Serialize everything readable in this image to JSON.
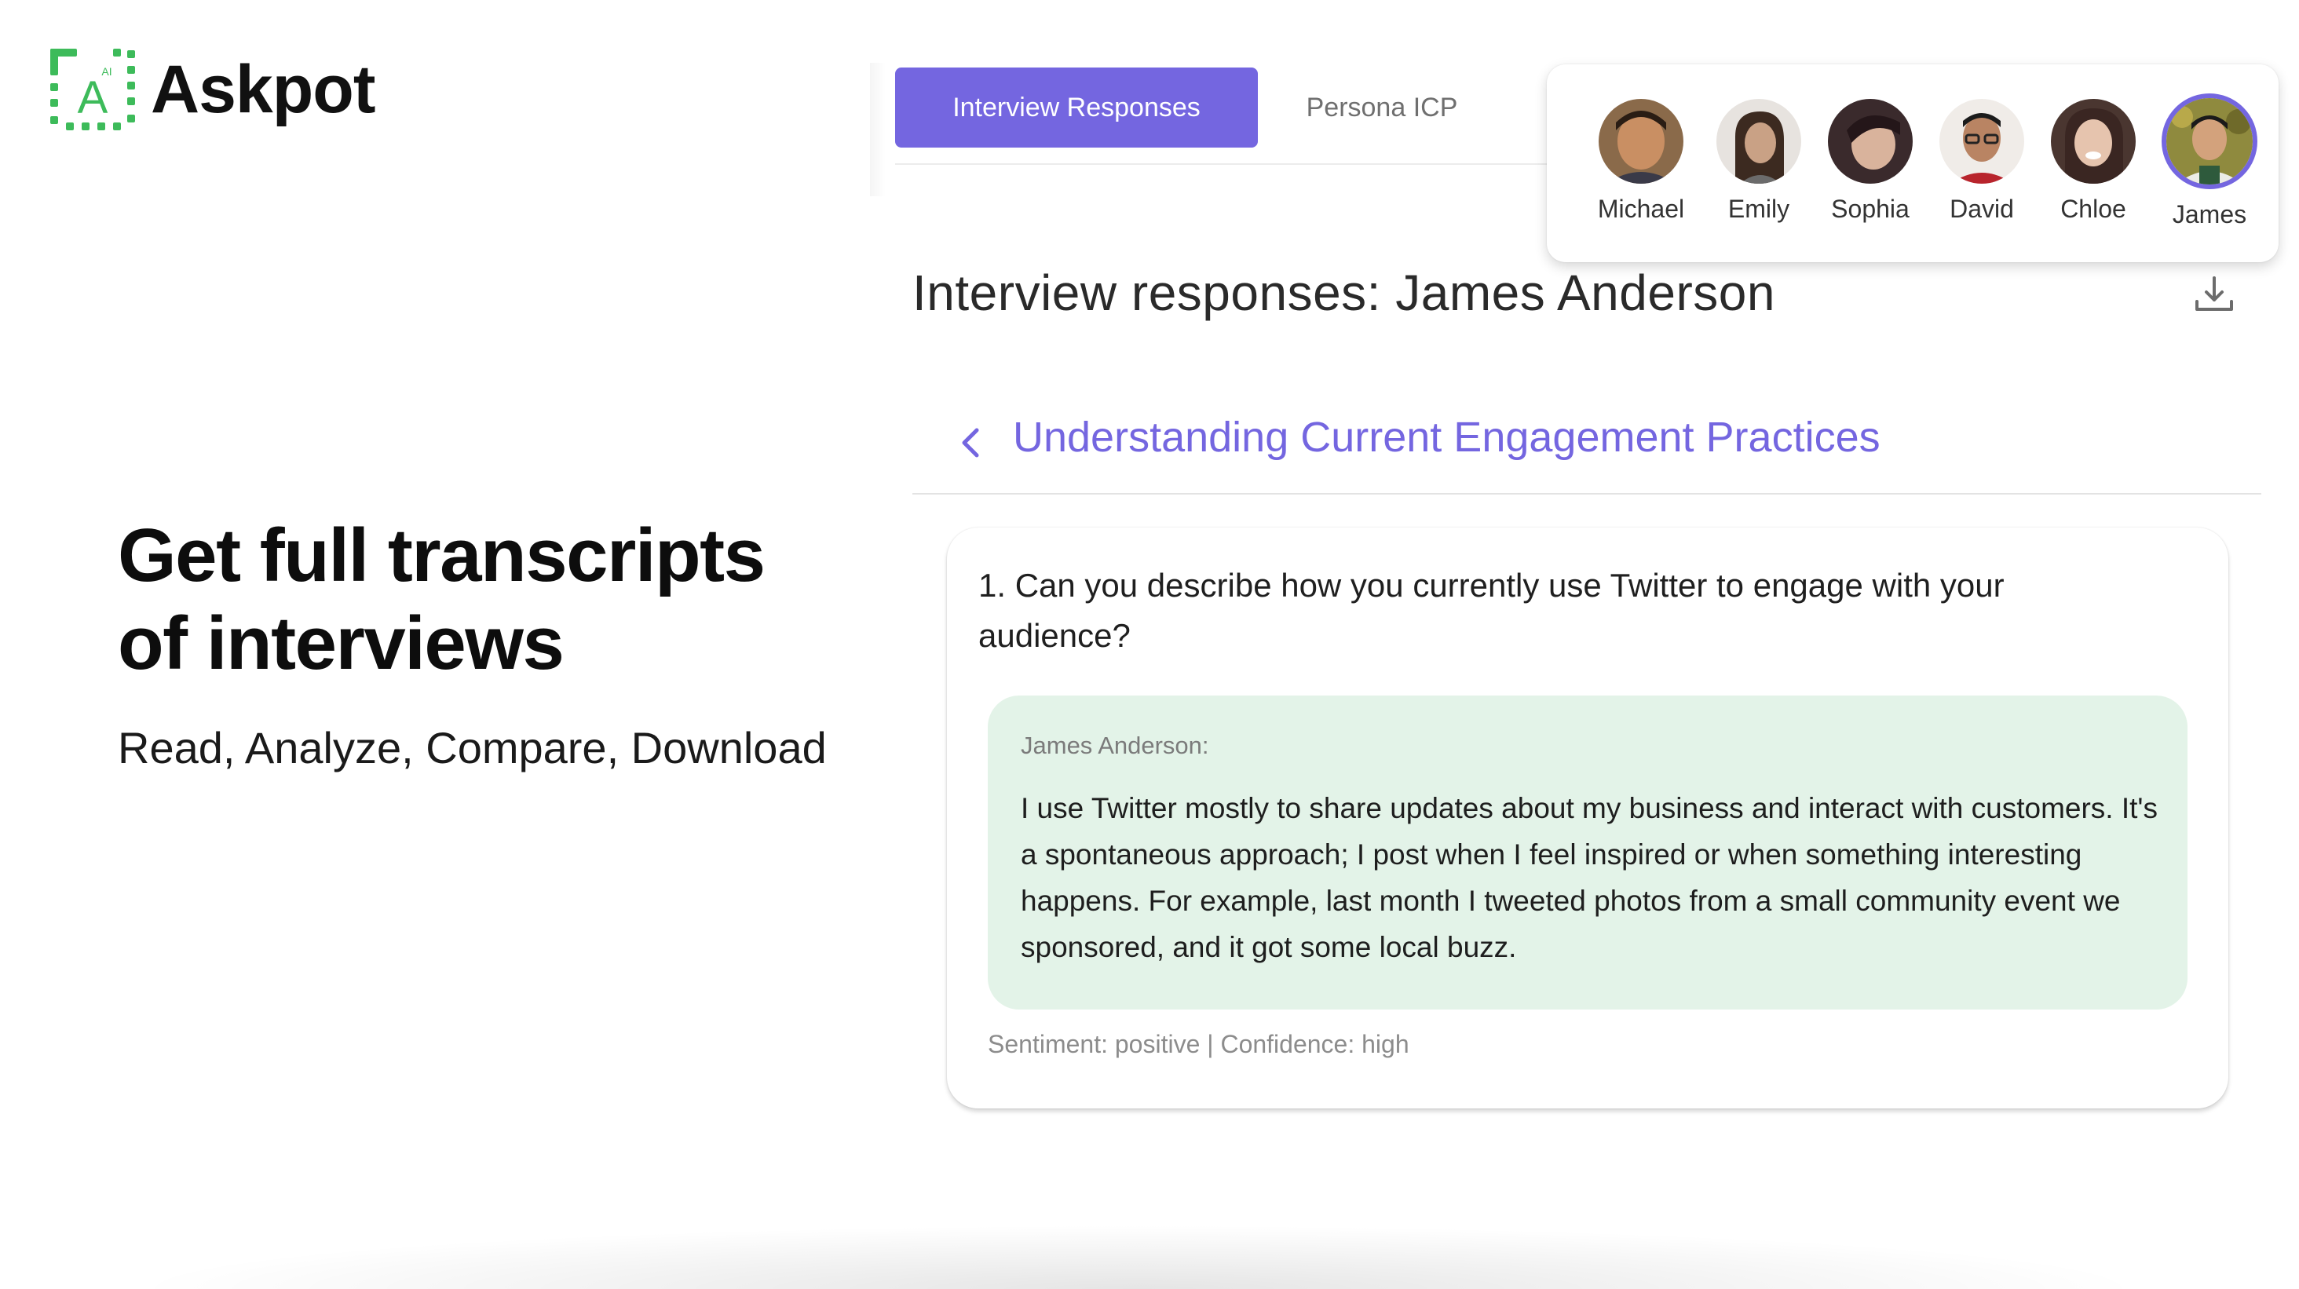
{
  "brand": {
    "logo_text": "Askpot",
    "logo_badge": "AI",
    "logo_letter": "A",
    "accent_green": "#3dbb5a"
  },
  "hero": {
    "title_line1": "Get full transcripts",
    "title_line2": "of interviews",
    "subtitle": "Read, Analyze, Compare, Download"
  },
  "tabs": [
    {
      "label": "Interview Responses",
      "active": true
    },
    {
      "label": "Persona ICP",
      "active": false
    }
  ],
  "personas": [
    {
      "name": "Michael",
      "selected": false,
      "icon": "avatar-photo"
    },
    {
      "name": "Emily",
      "selected": false,
      "icon": "avatar-photo"
    },
    {
      "name": "Sophia",
      "selected": false,
      "icon": "avatar-photo"
    },
    {
      "name": "David",
      "selected": false,
      "icon": "avatar-photo"
    },
    {
      "name": "Chloe",
      "selected": false,
      "icon": "avatar-photo"
    },
    {
      "name": "James",
      "selected": true,
      "icon": "avatar-photo"
    }
  ],
  "responses": {
    "heading": "Interview responses: James Anderson",
    "download_icon": "download-icon"
  },
  "section": {
    "title": "Understanding Current Engagement Practices",
    "back_icon": "chevron-left-icon"
  },
  "question": {
    "text": "1. Can you describe how you currently use Twitter to engage with your audience?",
    "speaker": "James Anderson:",
    "answer": "I use Twitter mostly to share updates about my business and interact with customers. It's a spontaneous approach; I post when I feel inspired or when something interesting happens. For example, last month I tweeted photos from a small community event we sponsored, and it got some local buzz.",
    "meta": "Sentiment: positive | Confidence: high"
  },
  "colors": {
    "accent": "#7466e0",
    "answer_bg": "#e3f3e8",
    "muted_text": "#8c8c8c"
  }
}
